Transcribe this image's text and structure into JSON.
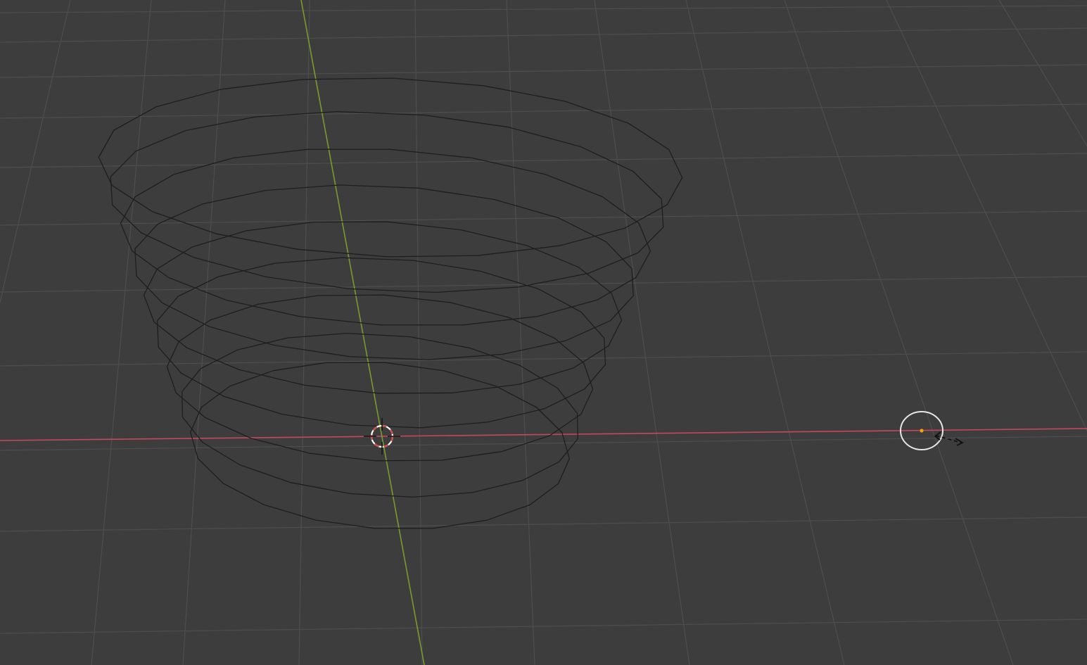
{
  "viewport": {
    "mode": "3D Viewport",
    "shading": "wireframe",
    "colors": {
      "background": "#3d3d3d",
      "grid": "#4e4e4e",
      "x_axis": "#c4495a",
      "y_axis": "#7a9a30",
      "wire": "#1e1e1e",
      "cursor_red": "#d24e4e",
      "cursor_white": "#ffffff",
      "origin": "#f3a10f",
      "light_gizmo": "#e6e6e6"
    }
  },
  "scene": {
    "object": "spiral-wireframe-mesh",
    "rings": 9,
    "extra_objects": [
      "3d-cursor",
      "light-gizmo"
    ]
  }
}
